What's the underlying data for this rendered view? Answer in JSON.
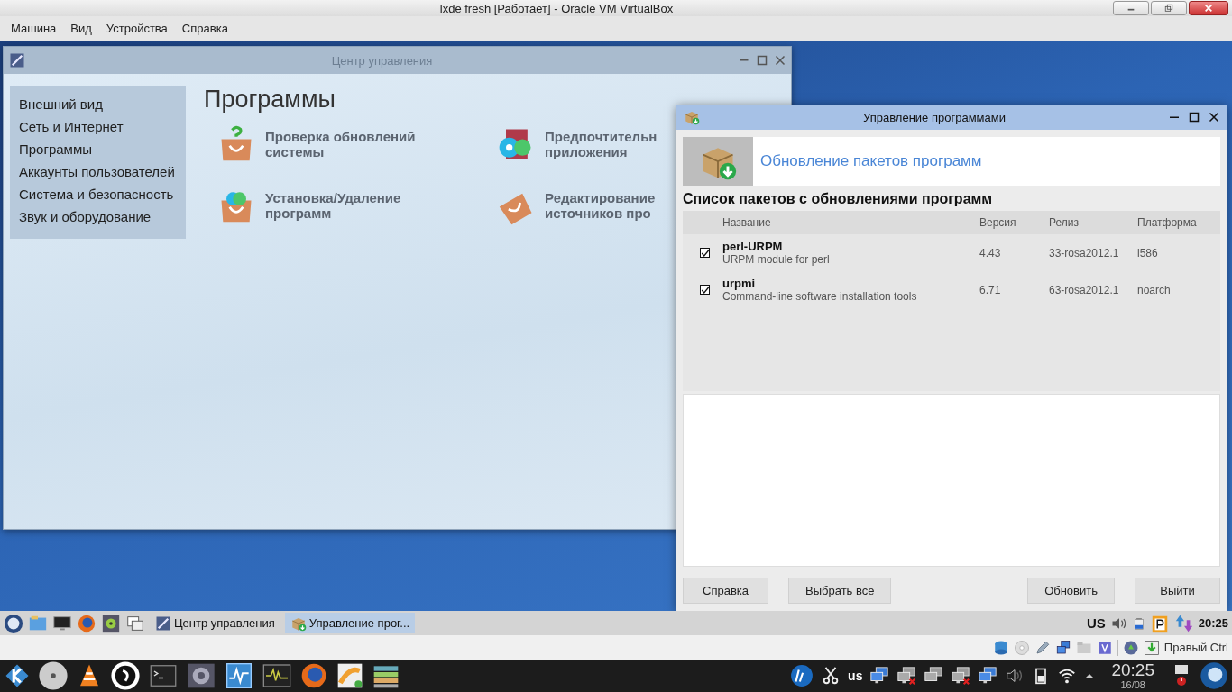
{
  "vbox": {
    "title": "lxde fresh [Работает] - Oracle VM VirtualBox",
    "menu": [
      "Машина",
      "Вид",
      "Устройства",
      "Справка"
    ]
  },
  "control_center": {
    "title": "Центр управления",
    "categories": [
      "Внешний вид",
      "Сеть и Интернет",
      "Программы",
      "Аккаунты пользователей",
      "Система и безопасность",
      "Звук и оборудование"
    ],
    "heading": "Программы",
    "items": [
      {
        "kind": "bag-question",
        "label": "Проверка обновлений\nсистемы"
      },
      {
        "kind": "discs",
        "label": "Предпочтительн\nприложения"
      },
      {
        "kind": "bag-discs",
        "label": "Установка/Удаление\nпрограмм"
      },
      {
        "kind": "bag-tilted",
        "label": "Редактирование\nисточников про"
      }
    ]
  },
  "update_window": {
    "title": "Управление программами",
    "banner": "Обновление пакетов программ",
    "heading": "Список пакетов с обновлениями программ",
    "columns": [
      "Название",
      "Версия",
      "Релиз",
      "Платформа"
    ],
    "packages": [
      {
        "checked": true,
        "name": "perl-URPM",
        "description": "URPM module for perl",
        "version": "4.43",
        "release": "33-rosa2012.1",
        "platform": "i586"
      },
      {
        "checked": true,
        "name": "urpmi",
        "description": "Command-line software installation tools",
        "version": "6.71",
        "release": "63-rosa2012.1",
        "platform": "noarch"
      }
    ],
    "buttons": [
      "Справка",
      "Выбрать все",
      "Обновить",
      "Выйти"
    ]
  },
  "guest_taskbar": {
    "tasks": [
      {
        "kind": "control-center",
        "label": "Центр управления",
        "selected": false
      },
      {
        "kind": "package",
        "label": "Управление прог...",
        "selected": true
      }
    ],
    "keyboard": "US",
    "clock": "20:25"
  },
  "vbox_status": {
    "host_key": "Правый Ctrl"
  },
  "host_taskbar": {
    "keyboard": "us",
    "time": "20:25",
    "date": "16/08"
  }
}
